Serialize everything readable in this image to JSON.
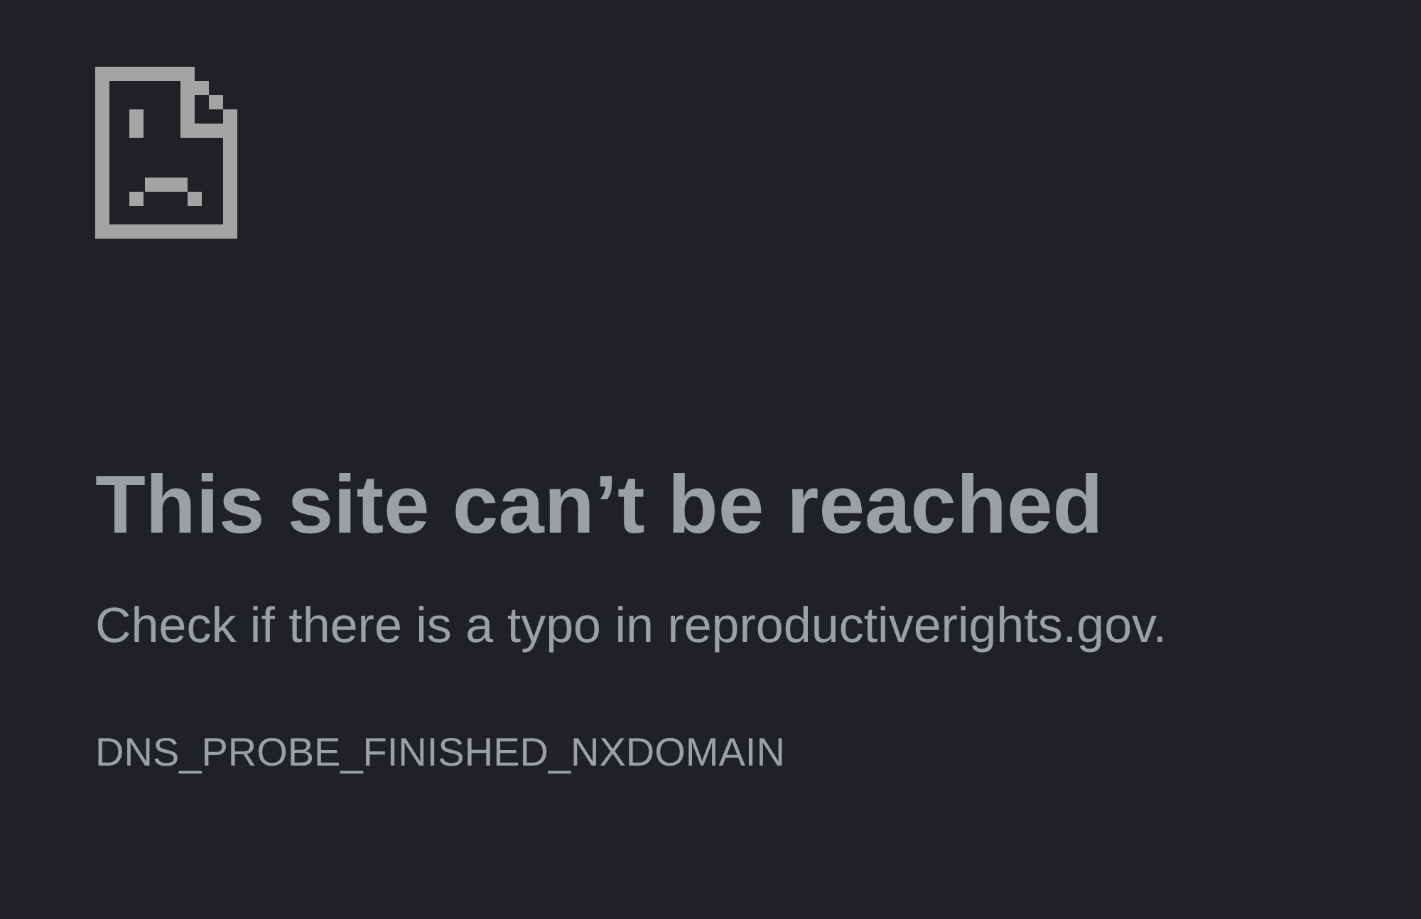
{
  "heading": "This site can’t be reached",
  "message": "Check if there is a typo in reproductiverights.gov.",
  "error_code": "DNS_PROBE_FINISHED_NXDOMAIN"
}
